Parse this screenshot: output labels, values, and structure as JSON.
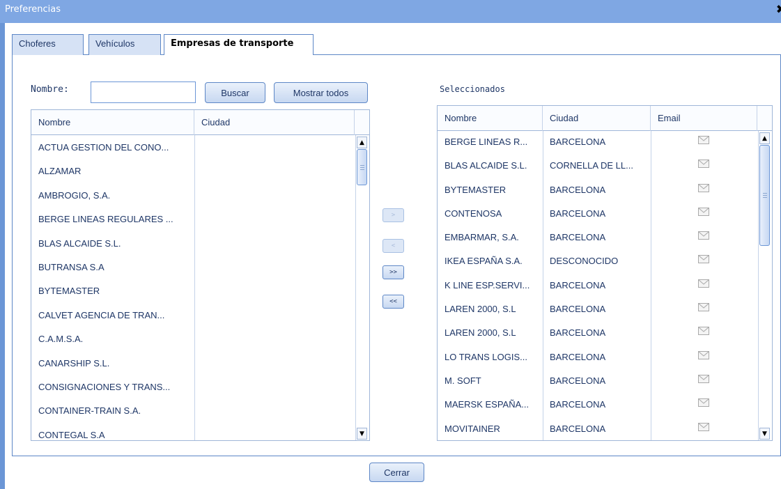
{
  "window": {
    "title": "Preferencias",
    "close_glyph": "✖"
  },
  "tabs": [
    {
      "label": "Choferes",
      "active": false
    },
    {
      "label": "Vehículos",
      "active": false
    },
    {
      "label": "Empresas de transporte",
      "active": true
    }
  ],
  "search": {
    "label": "Nombre:",
    "value": "",
    "search_button": "Buscar",
    "show_all_button": "Mostrar todos"
  },
  "available": {
    "columns": [
      "Nombre",
      "Ciudad"
    ],
    "rows": [
      [
        "ACTUA GESTION DEL CONO...",
        ""
      ],
      [
        "ALZAMAR",
        ""
      ],
      [
        "AMBROGIO, S.A.",
        ""
      ],
      [
        "BERGE LINEAS REGULARES ...",
        ""
      ],
      [
        "BLAS ALCAIDE S.L.",
        ""
      ],
      [
        "BUTRANSA S.A",
        ""
      ],
      [
        "BYTEMASTER",
        ""
      ],
      [
        "CALVET AGENCIA DE TRAN...",
        ""
      ],
      [
        "C.A.M.S.A.",
        ""
      ],
      [
        "CANARSHIP S.L.",
        ""
      ],
      [
        "CONSIGNACIONES Y TRANS...",
        ""
      ],
      [
        "CONTAINER-TRAIN S.A.",
        ""
      ],
      [
        "CONTEGAL S.A",
        ""
      ]
    ]
  },
  "move_buttons": {
    "add": ">",
    "remove": "<",
    "add_all": ">>",
    "remove_all": "<<"
  },
  "selected": {
    "label": "Seleccionados",
    "columns": [
      "Nombre",
      "Ciudad",
      "Email"
    ],
    "rows": [
      [
        "BERGE LINEAS R...",
        "BARCELONA"
      ],
      [
        "BLAS ALCAIDE S.L.",
        "CORNELLA DE LL..."
      ],
      [
        "BYTEMASTER",
        "BARCELONA"
      ],
      [
        "CONTENOSA",
        "BARCELONA"
      ],
      [
        "EMBARMAR, S.A.",
        "BARCELONA"
      ],
      [
        "IKEA ESPAÑA S.A.",
        "DESCONOCIDO"
      ],
      [
        "K LINE ESP.SERVI...",
        "BARCELONA"
      ],
      [
        "LAREN 2000, S.L",
        "BARCELONA"
      ],
      [
        "LAREN 2000, S.L",
        "BARCELONA"
      ],
      [
        "LO TRANS LOGIS...",
        "BARCELONA"
      ],
      [
        "M. SOFT",
        "BARCELONA"
      ],
      [
        "MAERSK ESPAÑA...",
        "BARCELONA"
      ],
      [
        "MOVITAINER",
        "BARCELONA"
      ]
    ]
  },
  "footer": {
    "close_button": "Cerrar"
  },
  "colors": {
    "titlebar": "#7fa7e3",
    "border": "#5c86c6",
    "text": "#1e3666"
  }
}
